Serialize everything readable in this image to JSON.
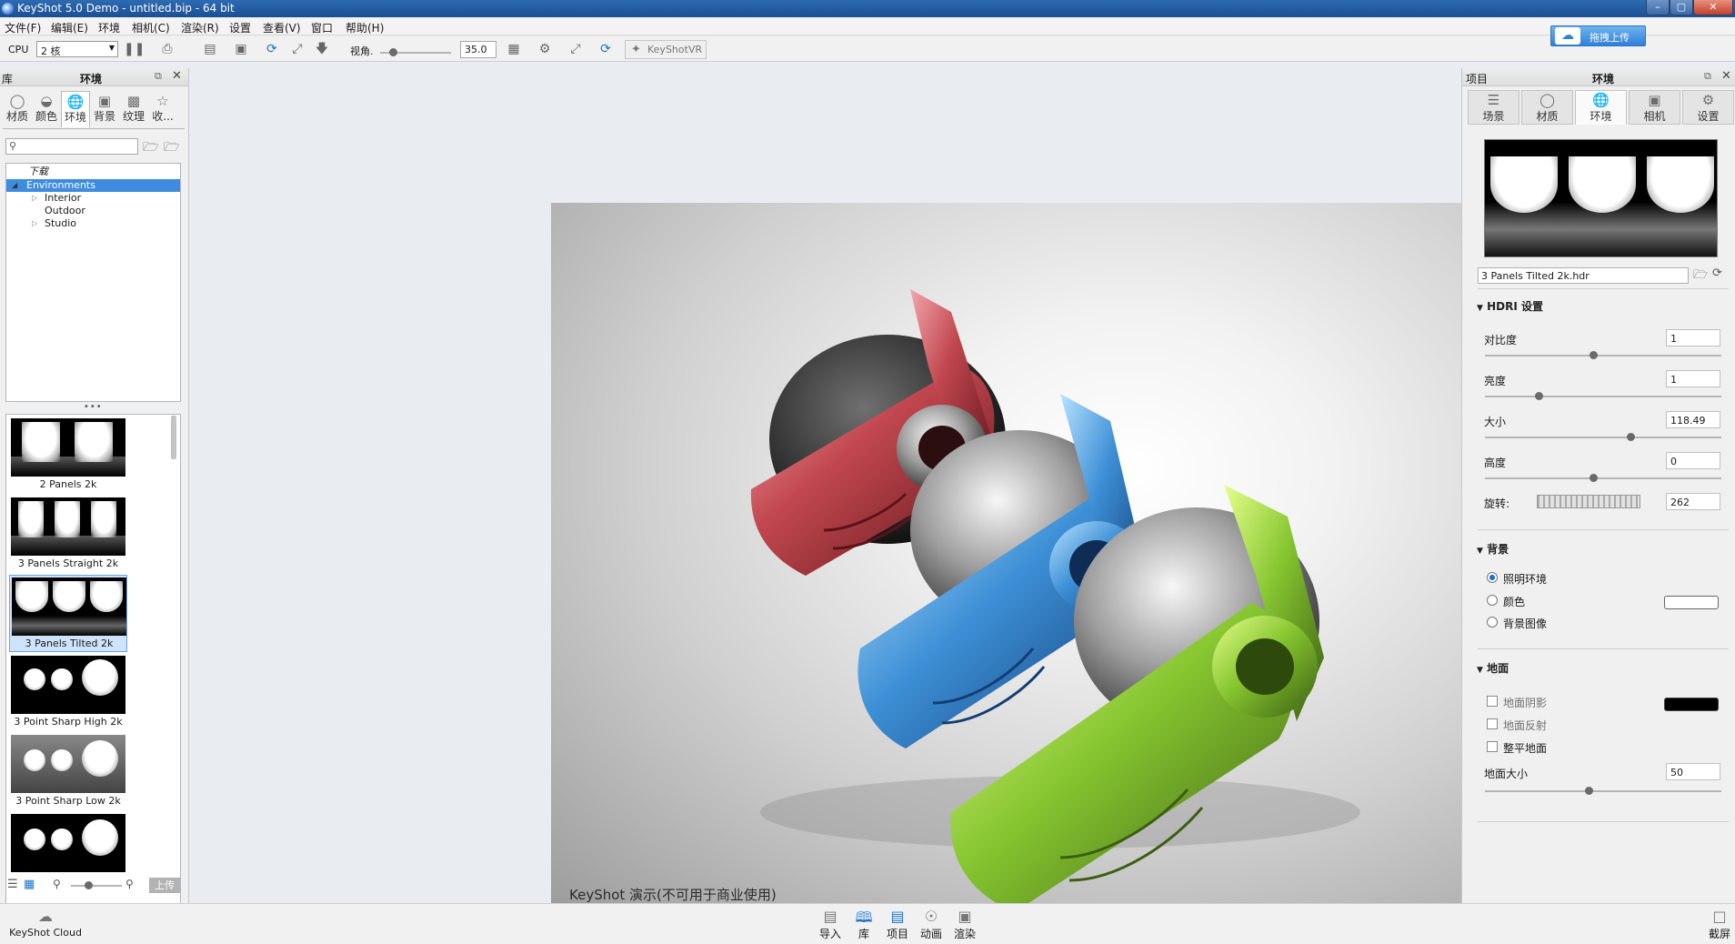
{
  "window": {
    "title": "KeyShot 5.0 Demo  - untitled.bip  - 64 bit"
  },
  "menu": [
    "文件(F)",
    "编辑(E)",
    "环境",
    "相机(C)",
    "渲染(R)",
    "设置",
    "查看(V)",
    "窗口",
    "帮助(H)"
  ],
  "toolbar": {
    "cpu_label": "CPU",
    "cores_value": "2 核",
    "fov_label": "视角.",
    "fov_value": "35.0",
    "vr_label": "KeyShotVR",
    "upload_label": "拖拽上传"
  },
  "library": {
    "title_left": "库",
    "title": "环境",
    "tabs": [
      {
        "label": "材质",
        "icon": "material-icon"
      },
      {
        "label": "颜色",
        "icon": "color-icon"
      },
      {
        "label": "环境",
        "icon": "globe-icon",
        "active": true
      },
      {
        "label": "背景",
        "icon": "image-icon"
      },
      {
        "label": "纹理",
        "icon": "texture-icon"
      },
      {
        "label": "收...",
        "icon": "star-icon"
      }
    ],
    "search_placeholder": "",
    "tree": [
      {
        "label": "下载",
        "level": 0
      },
      {
        "label": "Environments",
        "level": 0,
        "selected": true
      },
      {
        "label": "Interior",
        "level": 1
      },
      {
        "label": "Outdoor",
        "level": 1
      },
      {
        "label": "Studio",
        "level": 1
      }
    ],
    "thumbnails": [
      {
        "label": "2 Panels 2k"
      },
      {
        "label": "3 Panels Straight 2k"
      },
      {
        "label": "3 Panels Tilted 2k",
        "selected": true
      },
      {
        "label": "3 Point Sharp High 2k"
      },
      {
        "label": "3 Point Sharp Low 2k"
      },
      {
        "label": ""
      }
    ],
    "upload_button": "上传"
  },
  "viewport": {
    "watermark": "KeyShot 演示(不可用于商业使用)"
  },
  "project": {
    "title_left": "项目",
    "title": "环境",
    "tabs": [
      {
        "label": "场景",
        "icon": "scene-icon"
      },
      {
        "label": "材质",
        "icon": "material-icon"
      },
      {
        "label": "环境",
        "icon": "globe-icon",
        "active": true
      },
      {
        "label": "相机",
        "icon": "camera-icon"
      },
      {
        "label": "设置",
        "icon": "gear-icon"
      }
    ],
    "hdr_file": "3 Panels Tilted 2k.hdr",
    "hdri_section": "HDRI 设置",
    "params": [
      {
        "label": "对比度",
        "value": "1",
        "level": 0.46
      },
      {
        "label": "亮度",
        "value": "1",
        "level": 0.22
      },
      {
        "label": "大小",
        "value": "118.49",
        "level": 0.62
      },
      {
        "label": "高度",
        "value": "0",
        "level": 0.46
      }
    ],
    "rotation_label": "旋转:",
    "rotation_value": "262",
    "background_section": "背景",
    "background_options": [
      {
        "label": "照明环境",
        "checked": true
      },
      {
        "label": "颜色",
        "checked": false
      },
      {
        "label": "背景图像",
        "checked": false
      }
    ],
    "background_color": "#ffffff",
    "ground_section": "地面",
    "ground_options": [
      {
        "label": "地面阴影",
        "checked": false
      },
      {
        "label": "地面反射",
        "checked": false
      },
      {
        "label": "整平地面",
        "checked": false
      }
    ],
    "ground_shadow_color": "#000000",
    "ground_size_label": "地面大小",
    "ground_size_value": "50",
    "ground_size_level": 0.44
  },
  "bottombar": {
    "cloud": "KeyShot Cloud",
    "items": [
      {
        "label": "导入",
        "icon": "import-icon"
      },
      {
        "label": "库",
        "icon": "library-icon"
      },
      {
        "label": "项目",
        "icon": "project-icon"
      },
      {
        "label": "动画",
        "icon": "animation-icon"
      },
      {
        "label": "渲染",
        "icon": "render-icon"
      }
    ],
    "screenshot": "截屏"
  },
  "colors": {
    "accent": "#1f73c9",
    "selection": "#3e8ce0",
    "title_bar": "#1b4f94"
  }
}
